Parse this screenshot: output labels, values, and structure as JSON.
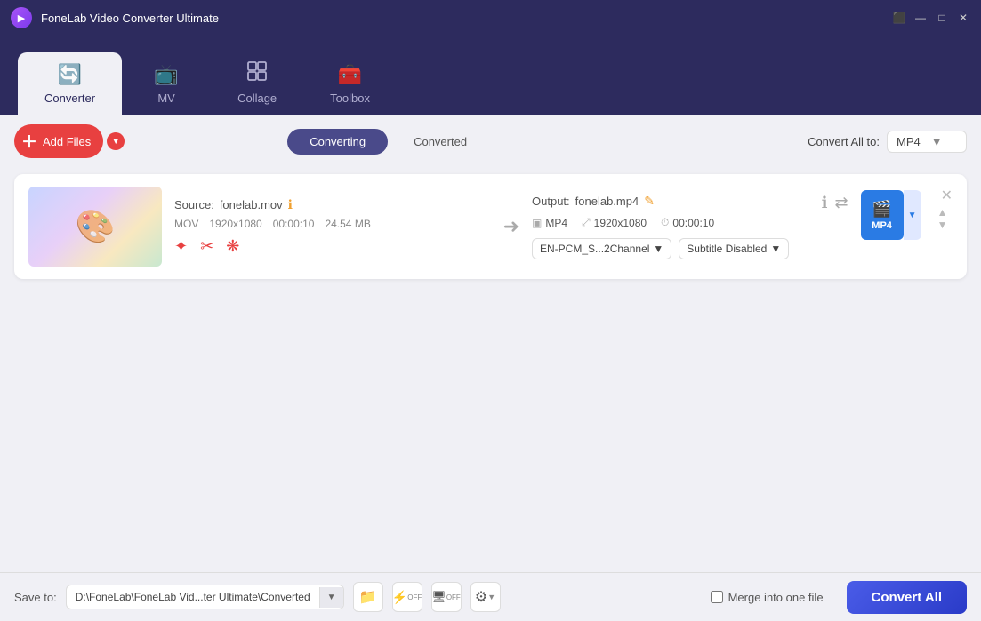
{
  "app": {
    "title": "FoneLab Video Converter Ultimate",
    "icon": "▶"
  },
  "window_controls": {
    "cc_label": "⬛",
    "minimize": "—",
    "maximize": "□",
    "close": "✕"
  },
  "nav": {
    "tabs": [
      {
        "id": "converter",
        "label": "Converter",
        "icon": "🔄",
        "active": true
      },
      {
        "id": "mv",
        "label": "MV",
        "icon": "📺",
        "active": false
      },
      {
        "id": "collage",
        "label": "Collage",
        "icon": "⊞",
        "active": false
      },
      {
        "id": "toolbox",
        "label": "Toolbox",
        "icon": "🧰",
        "active": false
      }
    ]
  },
  "toolbar": {
    "add_files_label": "Add Files",
    "converting_label": "Converting",
    "converted_label": "Converted",
    "convert_all_to_label": "Convert All to:",
    "format_selected": "MP4"
  },
  "file_item": {
    "source_label": "Source:",
    "source_file": "fonelab.mov",
    "format": "MOV",
    "resolution": "1920x1080",
    "duration": "00:00:10",
    "size": "24.54 MB",
    "output_label": "Output:",
    "output_file": "fonelab.mp4",
    "output_format": "MP4",
    "output_resolution": "1920x1080",
    "output_duration": "00:00:10",
    "audio_track": "EN-PCM_S...2Channel",
    "subtitle": "Subtitle Disabled"
  },
  "bottom_bar": {
    "save_to_label": "Save to:",
    "save_path": "D:\\FoneLab\\FoneLab Vid...ter Ultimate\\Converted",
    "merge_label": "Merge into one file",
    "convert_all_label": "Convert All"
  }
}
